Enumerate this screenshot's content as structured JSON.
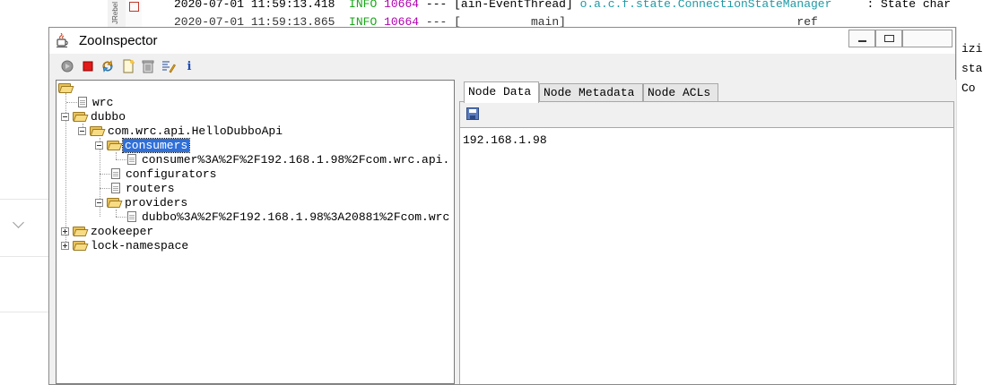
{
  "console": {
    "line1": {
      "timestamp": "2020-07-01 11:59:13.418",
      "level": "INFO",
      "pid": "10664",
      "sep": "---",
      "thread": "[ain-EventThread]",
      "logger": "o.a.c.f.state.ConnectionStateManager",
      "message": ": State char"
    },
    "line2": {
      "timestamp": "2020-07-01 11:59:13.865",
      "level": "INFO",
      "pid": "10664",
      "sep": "--- [",
      "thread": "main]",
      "message": "ref"
    },
    "right_edge": [
      "izi",
      "sta",
      "Co"
    ],
    "gutter_label": "JRebel"
  },
  "window": {
    "title": "ZooInspector"
  },
  "toolbar": {
    "buttons": [
      {
        "name": "connect-icon"
      },
      {
        "name": "disconnect-icon"
      },
      {
        "name": "refresh-icon"
      },
      {
        "name": "add-node-icon"
      },
      {
        "name": "delete-node-icon"
      },
      {
        "name": "node-viewers-icon"
      },
      {
        "name": "about-icon",
        "glyph": "i"
      }
    ]
  },
  "tree": {
    "nodes": {
      "wrc": "wrc",
      "dubbo": "dubbo",
      "api": "com.wrc.api.HelloDubboApi",
      "consumers": "consumers",
      "consumer_item": "consumer%3A%2F%2F192.168.1.98%2Fcom.wrc.api.",
      "configurators": "configurators",
      "routers": "routers",
      "providers": "providers",
      "provider_item": "dubbo%3A%2F%2F192.168.1.98%3A20881%2Fcom.wrc",
      "zookeeper": "zookeeper",
      "lock_namespace": "lock-namespace"
    }
  },
  "tabs": [
    "Node Data",
    "Node Metadata",
    "Node ACLs"
  ],
  "node_data": {
    "value": "192.168.1.98"
  }
}
